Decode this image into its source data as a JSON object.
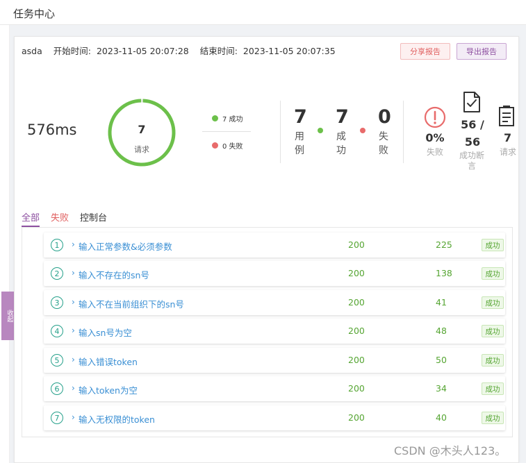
{
  "header": {
    "title": "任务中心"
  },
  "sidebar": {
    "collapse_label": "收起"
  },
  "report": {
    "name": "asda",
    "start_label": "开始时间:",
    "start_time": "2023-11-05 20:07:28",
    "end_label": "结束时间:",
    "end_time": "2023-11-05 20:07:35",
    "share_label": "分享报告",
    "export_label": "导出报告"
  },
  "summary": {
    "duration": "576ms",
    "requests_count": "7",
    "requests_label": "请求",
    "success_legend": "7 成功",
    "fail_legend": "0 失败",
    "cases_count": "7",
    "cases_label": "用例",
    "success_count": "7",
    "success_label": "成功",
    "fail_count": "0",
    "fail_label": "失败",
    "fail_rate": "0%",
    "fail_rate_label": "失败",
    "assert_value": "56 / 56",
    "assert_label": "成功断言",
    "requests_value": "7",
    "requests_stat_label": "请求",
    "success_ratio": 1.0
  },
  "colors": {
    "success": "#6cc04a",
    "fail": "#e86b6b",
    "accent": "#8d4fa0",
    "link": "#3a8fd4",
    "index": "#25a08a"
  },
  "tabs": [
    {
      "label": "全部",
      "active": true
    },
    {
      "label": "失败",
      "active": false
    },
    {
      "label": "控制台",
      "active": false
    }
  ],
  "rows": [
    {
      "index": "1",
      "name": "输入正常参数&必须参数",
      "code": "200",
      "time": "225",
      "status": "成功"
    },
    {
      "index": "2",
      "name": "输入不存在的sn号",
      "code": "200",
      "time": "138",
      "status": "成功"
    },
    {
      "index": "3",
      "name": "输入不在当前组织下的sn号",
      "code": "200",
      "time": "41",
      "status": "成功"
    },
    {
      "index": "4",
      "name": "输入sn号为空",
      "code": "200",
      "time": "48",
      "status": "成功"
    },
    {
      "index": "5",
      "name": "输入错误token",
      "code": "200",
      "time": "50",
      "status": "成功"
    },
    {
      "index": "6",
      "name": "输入token为空",
      "code": "200",
      "time": "34",
      "status": "成功"
    },
    {
      "index": "7",
      "name": "输入无权限的token",
      "code": "200",
      "time": "40",
      "status": "成功"
    }
  ],
  "watermark": "CSDN @木头人123。"
}
